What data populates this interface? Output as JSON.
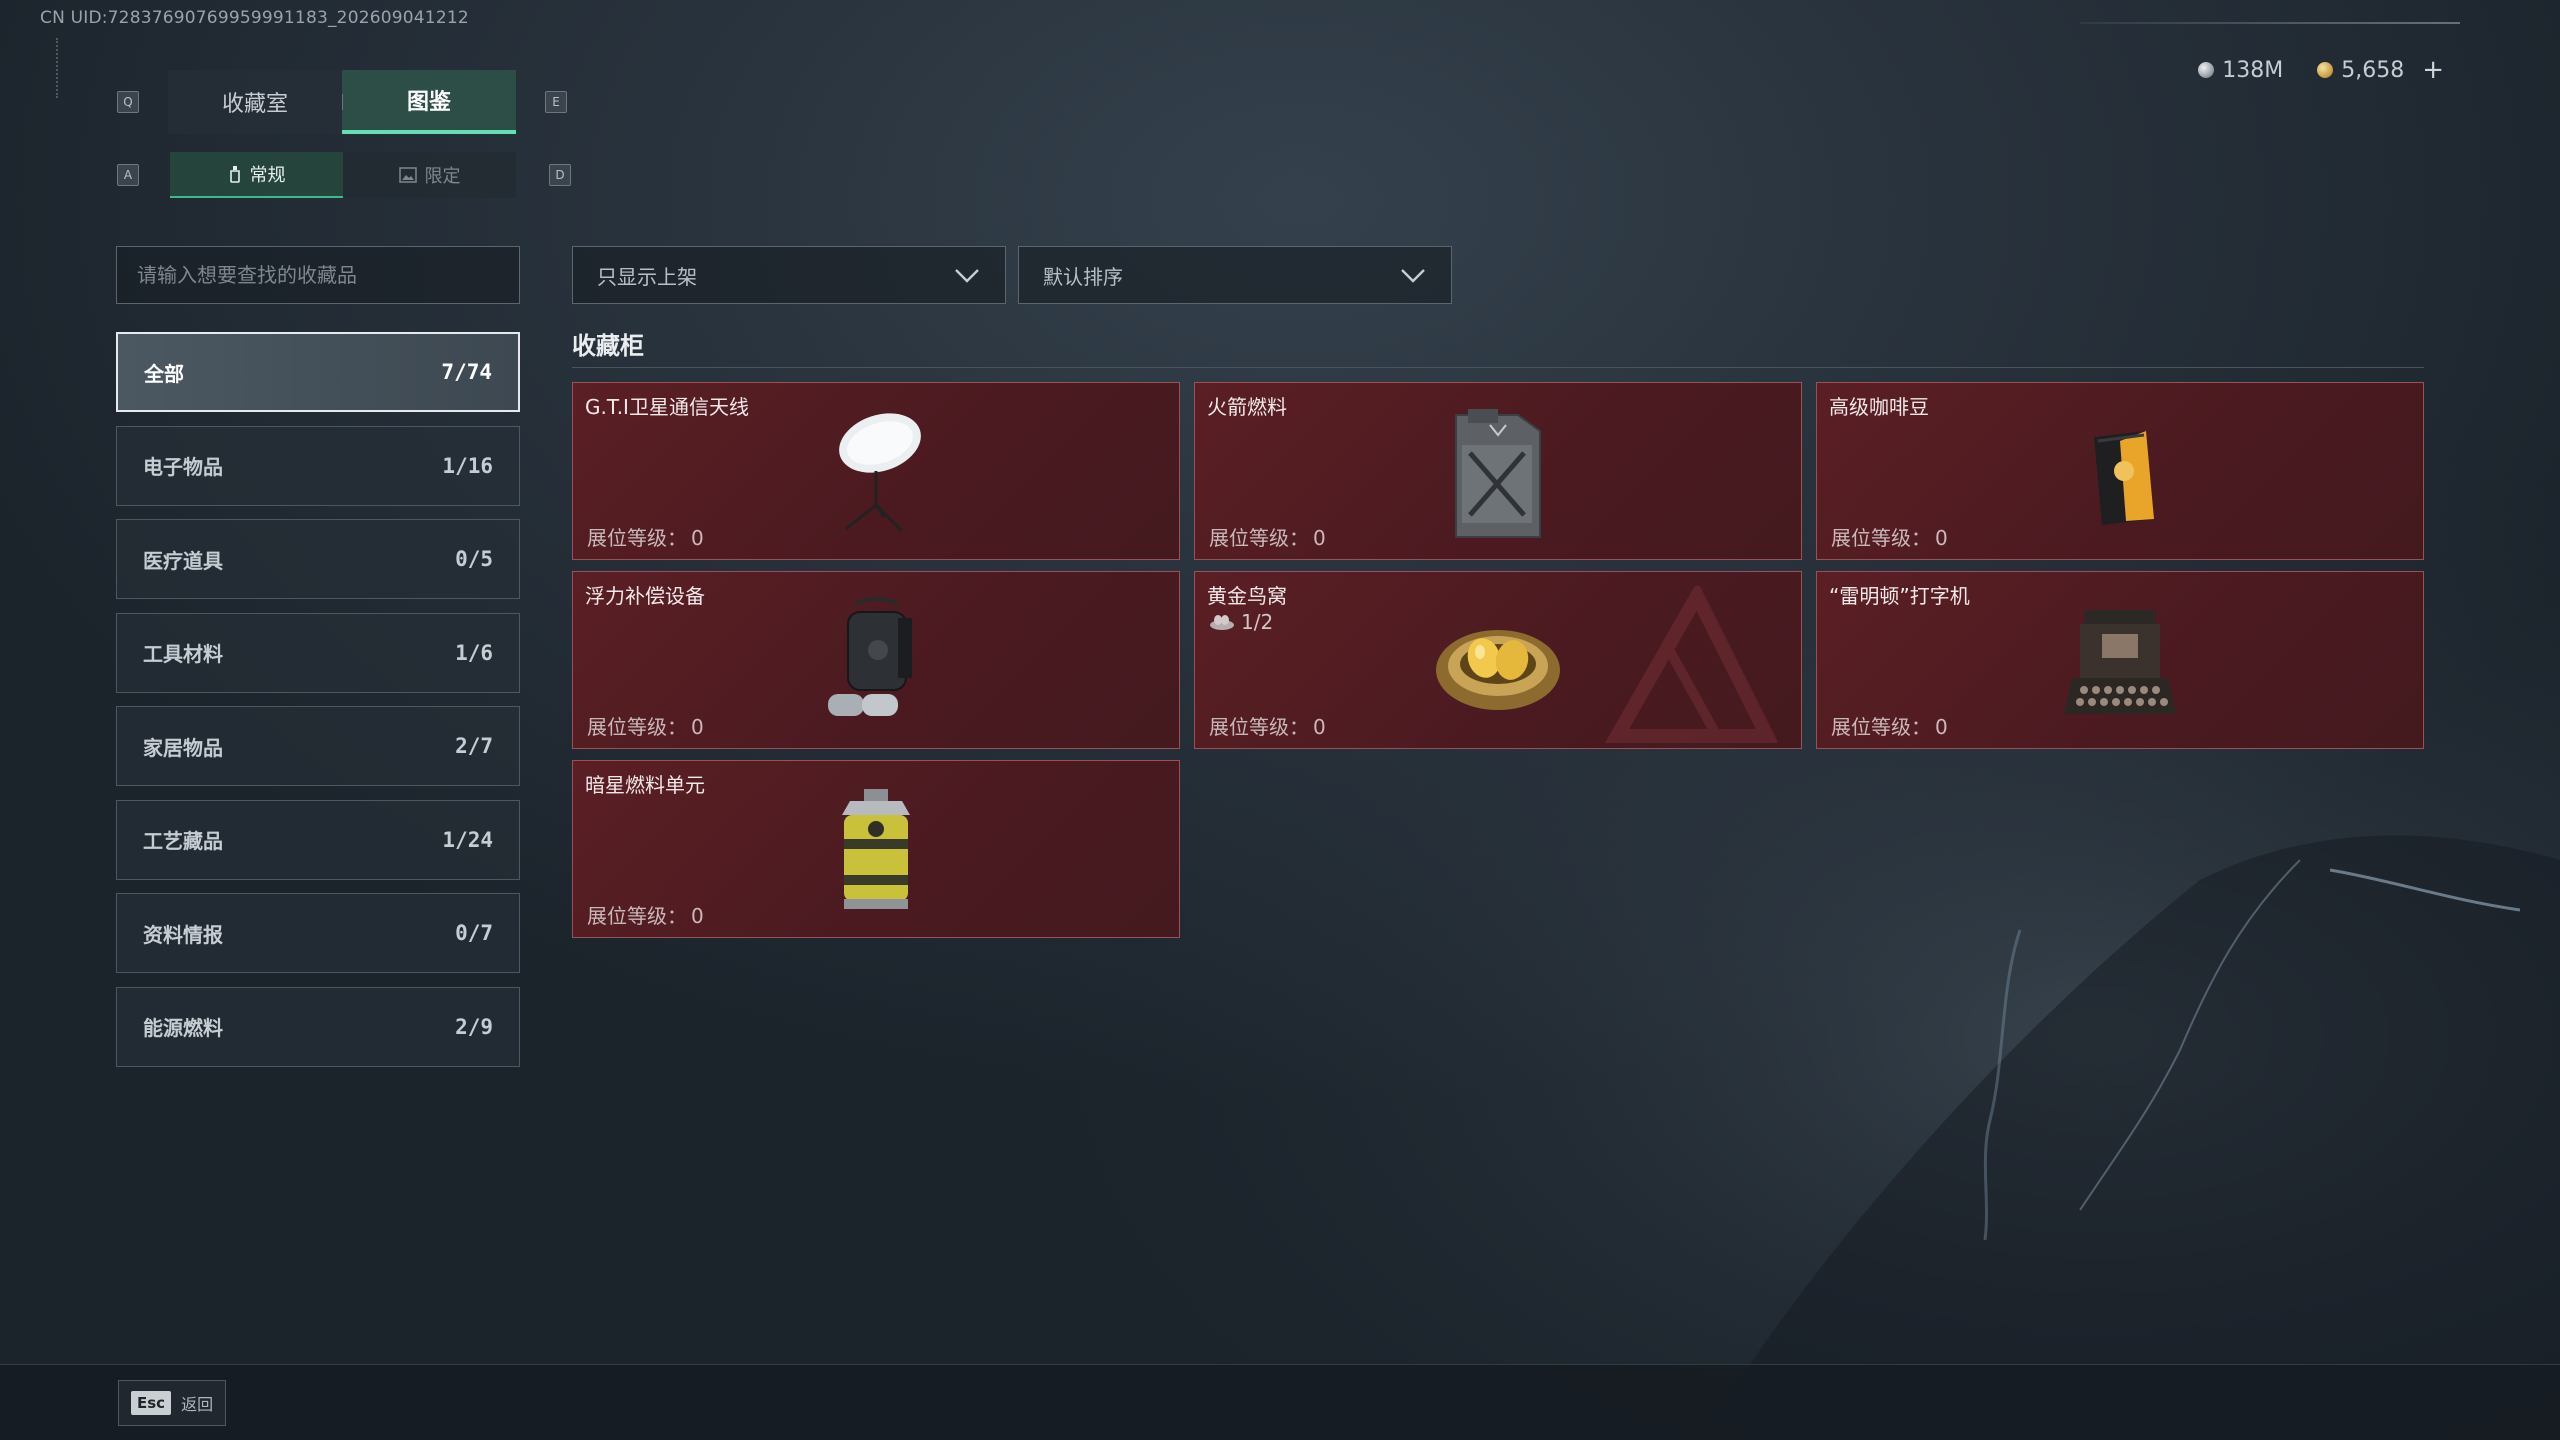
{
  "uid_text": "CN UID:72837690769959991183_202609041212",
  "currency": {
    "silver": "138M",
    "gold": "5,658",
    "plus": "+"
  },
  "keys": {
    "q": "Q",
    "e": "E",
    "a": "A",
    "d": "D"
  },
  "tabs": [
    {
      "label": "收藏室",
      "active": false
    },
    {
      "label": "图鉴",
      "active": true
    }
  ],
  "subtabs": [
    {
      "label": "常规",
      "active": true
    },
    {
      "label": "限定",
      "active": false
    }
  ],
  "search": {
    "placeholder": "请输入想要查找的收藏品",
    "value": ""
  },
  "categories": [
    {
      "label": "全部",
      "count": "7/74",
      "active": true
    },
    {
      "label": "电子物品",
      "count": "1/16"
    },
    {
      "label": "医疗道具",
      "count": "0/5"
    },
    {
      "label": "工具材料",
      "count": "1/6"
    },
    {
      "label": "家居物品",
      "count": "2/7"
    },
    {
      "label": "工艺藏品",
      "count": "1/24"
    },
    {
      "label": "资料情报",
      "count": "0/7"
    },
    {
      "label": "能源燃料",
      "count": "2/9"
    }
  ],
  "filters": {
    "shelf": "只显示上架",
    "sort": "默认排序"
  },
  "section_title": "收藏柜",
  "level_label": "展位等级：",
  "items": [
    {
      "name": "G.T.I卫星通信天线",
      "level": "0",
      "icon": "satellite-dish-icon"
    },
    {
      "name": "火箭燃料",
      "level": "0",
      "icon": "fuel-canister-icon"
    },
    {
      "name": "高级咖啡豆",
      "level": "0",
      "icon": "coffee-bag-icon"
    },
    {
      "name": "浮力补偿设备",
      "level": "0",
      "icon": "buoyancy-device-icon"
    },
    {
      "name": "黄金鸟窝",
      "level": "0",
      "progress": "1/2",
      "icon": "golden-nest-icon"
    },
    {
      "name": "“雷明顿”打字机",
      "level": "0",
      "icon": "typewriter-icon"
    },
    {
      "name": "暗星燃料单元",
      "level": "0",
      "icon": "fuel-cell-icon"
    }
  ],
  "back": {
    "key": "Esc",
    "label": "返回"
  },
  "colors": {
    "accent": "#63e0b3",
    "card_bg": "#4e1b21",
    "card_border": "#9a5059"
  }
}
